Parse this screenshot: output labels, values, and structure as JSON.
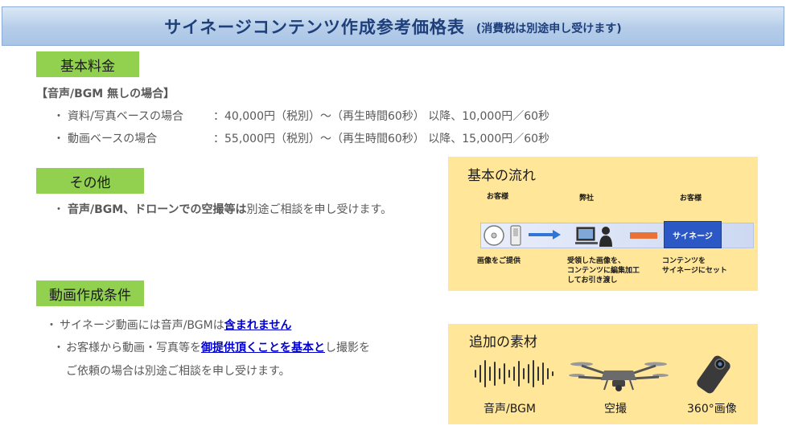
{
  "title": {
    "main": "サイネージコンテンツ作成参考価格表",
    "sub": "(消費税は別途申し受けます)"
  },
  "basic_fee": {
    "tag": "基本料金",
    "header": "【音声/BGM 無しの場合】",
    "items": [
      {
        "bullet": "・",
        "name": "資料/写真ベースの場合",
        "price": "：40,000円（税別）～（再生時間60秒） 以降、10,000円／60秒"
      },
      {
        "bullet": "・",
        "name": "動画ベースの場合",
        "price": "：55,000円（税別）～（再生時間60秒） 以降、15,000円／60秒"
      }
    ]
  },
  "other": {
    "tag": "その他",
    "bullet": "・",
    "text_bold": "音声/BGM、ドローンでの空撮等は",
    "text_rest": "別途ご相談を申し受けます。"
  },
  "conditions": {
    "tag": "動画作成条件",
    "line1": {
      "bullet": "・",
      "pre": "サイネージ動画には音声/BGMは",
      "link": "含まれません"
    },
    "line2": {
      "bullet": "・",
      "pre": "お客様から動画・写真等を",
      "link": "御提供頂くことを基本と",
      "post": "し撮影を"
    },
    "line3": "ご依頼の場合は別途ご相談を申し受けます。"
  },
  "flow": {
    "title": "基本の流れ",
    "customer_label": "お客様",
    "company_label": "弊社",
    "customer_label_2": "お客様",
    "signage_label": "サイネージ",
    "caption_1": "画像をご提供",
    "caption_2": [
      "受領した画像を、",
      "コンテンツに編集加工",
      "してお引き渡し"
    ],
    "caption_3": [
      "コンテンツを",
      "サイネージにセット"
    ]
  },
  "materials": {
    "title": "追加の素材",
    "items": [
      {
        "label": "音声/BGM",
        "icon": "sound-wave-icon"
      },
      {
        "label": "空撮",
        "icon": "drone-icon"
      },
      {
        "label": "360°画像",
        "icon": "360-camera-icon"
      }
    ]
  },
  "colors": {
    "tag_green": "#92d050",
    "panel_yellow": "#ffe699",
    "title_blue": "#1f3f7a",
    "link_blue": "#0000cc",
    "arrow_blue": "#2e75d6",
    "arrow_orange": "#e8733a"
  }
}
